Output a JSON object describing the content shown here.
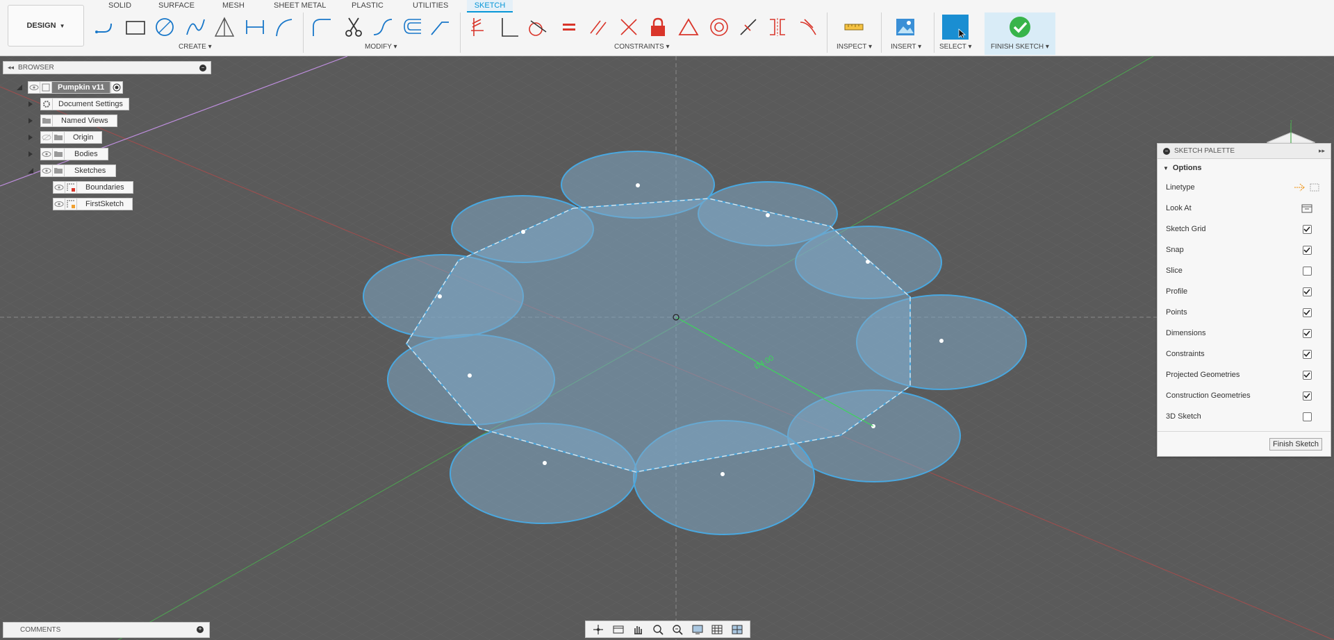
{
  "workspace": {
    "label": "DESIGN"
  },
  "tabs": [
    {
      "label": "SOLID"
    },
    {
      "label": "SURFACE"
    },
    {
      "label": "MESH"
    },
    {
      "label": "SHEET METAL"
    },
    {
      "label": "PLASTIC"
    },
    {
      "label": "UTILITIES"
    },
    {
      "label": "SKETCH",
      "active": true
    }
  ],
  "groups": {
    "create": "CREATE",
    "modify": "MODIFY",
    "constraints": "CONSTRAINTS",
    "inspect": "INSPECT",
    "insert": "INSERT",
    "select": "SELECT",
    "finish": "FINISH SKETCH"
  },
  "browser": {
    "title": "BROWSER",
    "root": "Pumpkin v11",
    "nodes": {
      "document_settings": "Document Settings",
      "named_views": "Named Views",
      "origin": "Origin",
      "bodies": "Bodies",
      "sketches": "Sketches",
      "boundaries": "Boundaries",
      "first_sketch": "FirstSketch"
    }
  },
  "palette": {
    "title": "SKETCH PALETTE",
    "section": "Options",
    "rows": {
      "linetype": {
        "label": "Linetype"
      },
      "look_at": {
        "label": "Look At"
      },
      "sketch_grid": {
        "label": "Sketch Grid",
        "checked": true
      },
      "snap": {
        "label": "Snap",
        "checked": true
      },
      "slice": {
        "label": "Slice",
        "checked": false
      },
      "profile": {
        "label": "Profile",
        "checked": true
      },
      "points": {
        "label": "Points",
        "checked": true
      },
      "dimensions": {
        "label": "Dimensions",
        "checked": true
      },
      "constraints": {
        "label": "Constraints",
        "checked": true
      },
      "projected": {
        "label": "Projected Geometries",
        "checked": true
      },
      "construction": {
        "label": "Construction Geometries",
        "checked": true
      },
      "sketch3d": {
        "label": "3D Sketch",
        "checked": false
      }
    },
    "finish_button": "Finish Sketch"
  },
  "comments": {
    "title": "COMMENTS"
  },
  "dimension_label": "Ø4.00",
  "colors": {
    "accent": "#0696d7",
    "finish_green": "#38b44a",
    "sketch_line": "#4aa8e0",
    "sketch_fill": "#7fa8c4",
    "grid": "#6b6b6b",
    "viewport_bg": "#5a5a5a",
    "constraint_red": "#d9352a"
  }
}
